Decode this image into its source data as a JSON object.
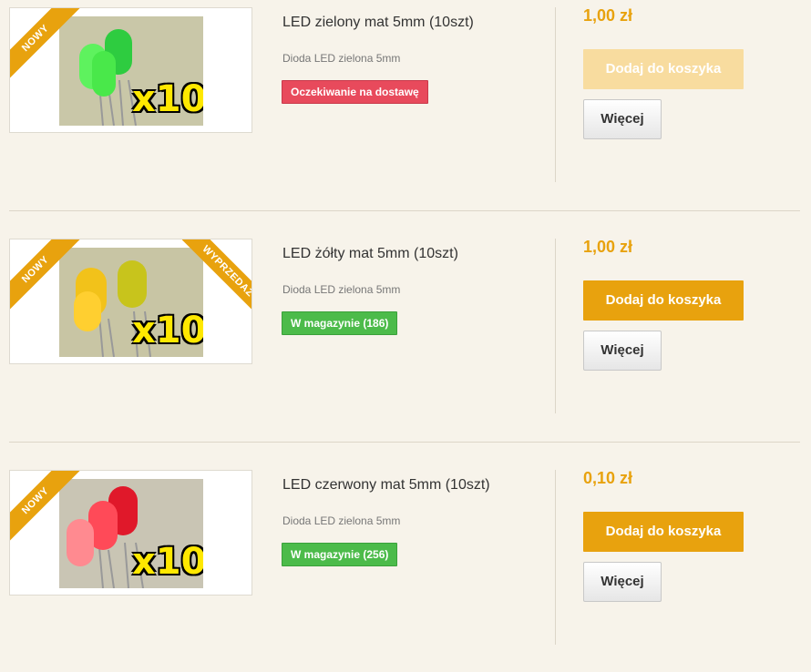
{
  "products": [
    {
      "name": "LED zielony mat 5mm (10szt)",
      "description": "Dioda LED zielona 5mm",
      "status": "Oczekiwanie na dostawę",
      "price": "1,00 zł",
      "cart_label": "Dodaj do koszyka",
      "more_label": "Więcej",
      "ribbon_left": "NOWY",
      "photo_text": "x10"
    },
    {
      "name": "LED żółty mat 5mm (10szt)",
      "description": "Dioda LED zielona 5mm",
      "status": "W magazynie (186)",
      "price": "1,00 zł",
      "cart_label": "Dodaj do koszyka",
      "more_label": "Więcej",
      "ribbon_left": "NOWY",
      "ribbon_right": "WYPRZEDAŻ",
      "photo_text": "x10"
    },
    {
      "name": "LED czerwony mat 5mm (10szt)",
      "description": "Dioda LED zielona 5mm",
      "status": "W magazynie (256)",
      "price": "0,10 zł",
      "cart_label": "Dodaj do koszyka",
      "more_label": "Więcej",
      "ribbon_left": "NOWY",
      "photo_text": "x10"
    }
  ],
  "colors": {
    "accent": "#e8a20e",
    "out_of_stock": "#e84a5c",
    "in_stock": "#4cbb4a",
    "background": "#f7f3ea"
  }
}
